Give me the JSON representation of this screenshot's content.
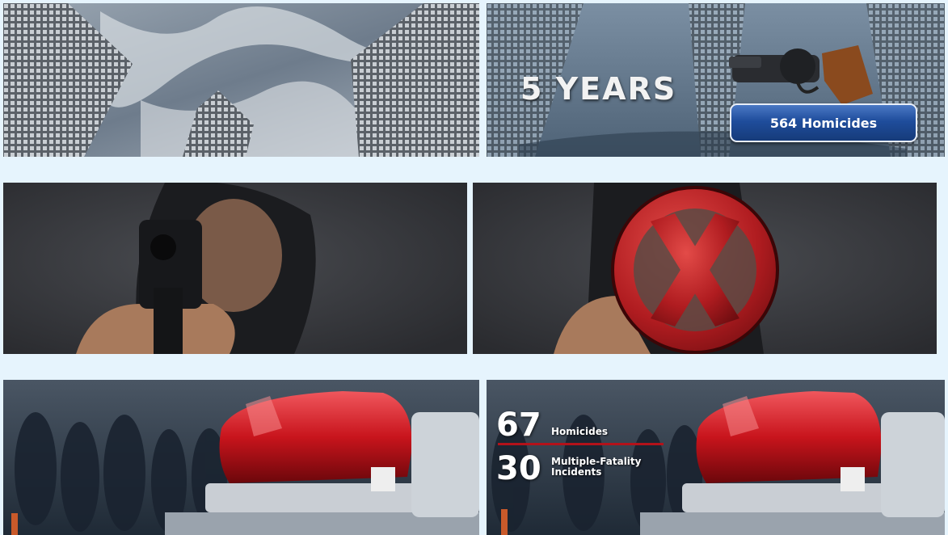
{
  "slides": [
    {
      "name": "skyscrapers-looking-up"
    },
    {
      "name": "skyscrapers-with-revolver",
      "headline": "5 YEARS",
      "badge": "564 Homicides"
    },
    {
      "name": "man-pointing-gun"
    },
    {
      "name": "man-pointing-gun-crossed-out"
    },
    {
      "name": "police-light-bar"
    },
    {
      "name": "police-light-bar-stats",
      "stats": [
        {
          "number": "67",
          "label_line1": "Homicides",
          "label_line2": ""
        },
        {
          "number": "30",
          "label_line1": "Multiple-Fatality",
          "label_line2": "Incidents"
        }
      ]
    }
  ],
  "colors": {
    "page_background": "#e6f4fd",
    "badge_blue": "#1f4d9c",
    "stat_red_rule": "#b3121a",
    "police_light_red": "#c8141c"
  }
}
